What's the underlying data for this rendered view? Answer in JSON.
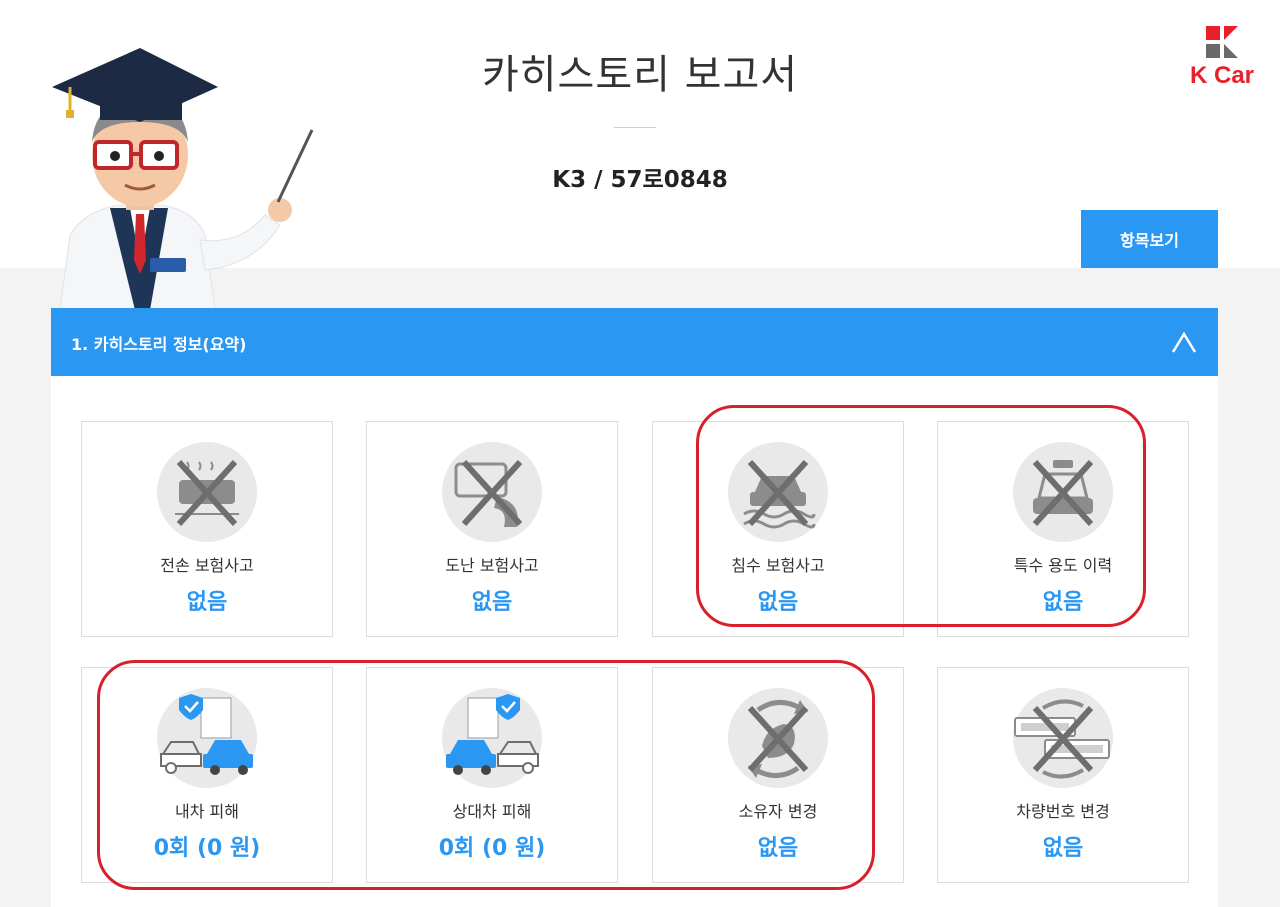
{
  "header": {
    "title": "카히스토리 보고서",
    "car_plate": "K3 / 57로0848",
    "brand": "K Car",
    "view_items_label": "항목보기"
  },
  "section": {
    "title": "1. 카히스토리 정보(요약)"
  },
  "cards": [
    {
      "label": "전손 보험사고",
      "value": "없음",
      "icon": "total-loss-icon"
    },
    {
      "label": "도난 보험사고",
      "value": "없음",
      "icon": "theft-icon"
    },
    {
      "label": "침수 보험사고",
      "value": "없음",
      "icon": "flood-icon"
    },
    {
      "label": "특수 용도 이력",
      "value": "없음",
      "icon": "special-use-icon"
    },
    {
      "label": "내차 피해",
      "value": "0회 (0 원)",
      "icon": "own-damage-icon"
    },
    {
      "label": "상대차 피해",
      "value": "0회 (0 원)",
      "icon": "other-damage-icon"
    },
    {
      "label": "소유자 변경",
      "value": "없음",
      "icon": "owner-change-icon"
    },
    {
      "label": "차량번호 변경",
      "value": "없음",
      "icon": "plate-change-icon"
    }
  ],
  "colors": {
    "accent": "#2a97f2",
    "brand": "#e8202a",
    "highlight": "#d8202a"
  }
}
